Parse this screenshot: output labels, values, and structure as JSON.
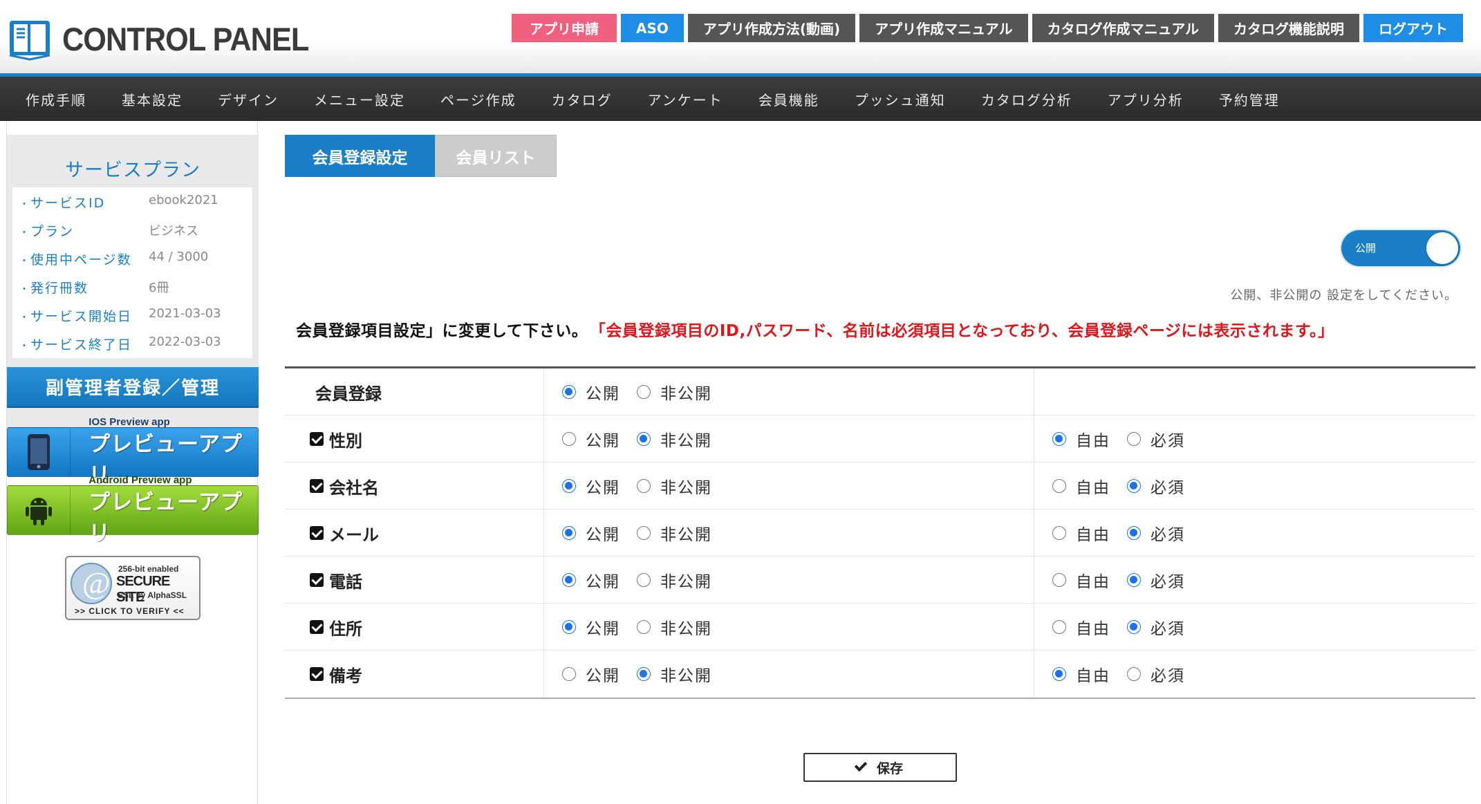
{
  "header": {
    "logo_text": "CONTROL PANEL",
    "buttons": [
      "アプリ申請",
      "ASO",
      "アプリ作成方法(動画)",
      "アプリ作成マニュアル",
      "カタログ作成マニュアル",
      "カタログ機能説明",
      "ログアウト"
    ]
  },
  "nav": [
    "作成手順",
    "基本設定",
    "デザイン",
    "メニュー設定",
    "ページ作成",
    "カタログ",
    "アンケート",
    "会員機能",
    "プッシュ通知",
    "カタログ分析",
    "アプリ分析",
    "予約管理"
  ],
  "sidebar": {
    "plan_title": "サービスプラン",
    "plan": [
      {
        "label": "サービスID",
        "value": "ebook2021"
      },
      {
        "label": "プラン",
        "value": "ビジネス"
      },
      {
        "label": "使用中ページ数",
        "value": "44 / 3000"
      },
      {
        "label": "発行冊数",
        "value": "6冊"
      },
      {
        "label": "サービス開始日",
        "value": "2021-03-03"
      },
      {
        "label": "サービス終了日",
        "value": "2022-03-03"
      }
    ],
    "sub_admin_button": "副管理者登録／管理",
    "ios_preview": {
      "small": "IOS Preview app",
      "big": "プレビューアプリ"
    },
    "android_preview": {
      "small": "Android Preview app",
      "big": "プレビューアプリ"
    },
    "ssl": {
      "line1": "256-bit enabled",
      "line2": "SECURE SITE",
      "line3": "SSL by AlphaSSL",
      "line4": ">> CLICK TO VERIFY <<"
    }
  },
  "tabs": [
    "会員登録設定",
    "会員リスト"
  ],
  "toggle": {
    "label": "公開",
    "on": true,
    "hint": "公開、非公開の 設定をしてください。"
  },
  "notice": {
    "black": "会員登録項目設定」に変更して下さい。",
    "red": "「会員登録項目のID,パスワード、名前は必須項目となっており、会員登録ページには表示されます。」"
  },
  "options": {
    "public": "公開",
    "private": "非公開",
    "free": "自由",
    "required": "必須"
  },
  "rows": [
    {
      "label": "会員登録",
      "checkbox": false,
      "visibility": "public",
      "requirement": null
    },
    {
      "label": "性別",
      "checkbox": true,
      "visibility": "private",
      "requirement": "free"
    },
    {
      "label": "会社名",
      "checkbox": true,
      "visibility": "public",
      "requirement": "required"
    },
    {
      "label": "メール",
      "checkbox": true,
      "visibility": "public",
      "requirement": "required"
    },
    {
      "label": "電話",
      "checkbox": true,
      "visibility": "public",
      "requirement": "required"
    },
    {
      "label": "住所",
      "checkbox": true,
      "visibility": "public",
      "requirement": "required"
    },
    {
      "label": "備考",
      "checkbox": true,
      "visibility": "private",
      "requirement": "free"
    }
  ],
  "save_label": "保存",
  "colors": {
    "accent": "#1a7fc6",
    "pink": "#f0617f",
    "red_text": "#e0161b",
    "android_green": "#7cc323"
  }
}
